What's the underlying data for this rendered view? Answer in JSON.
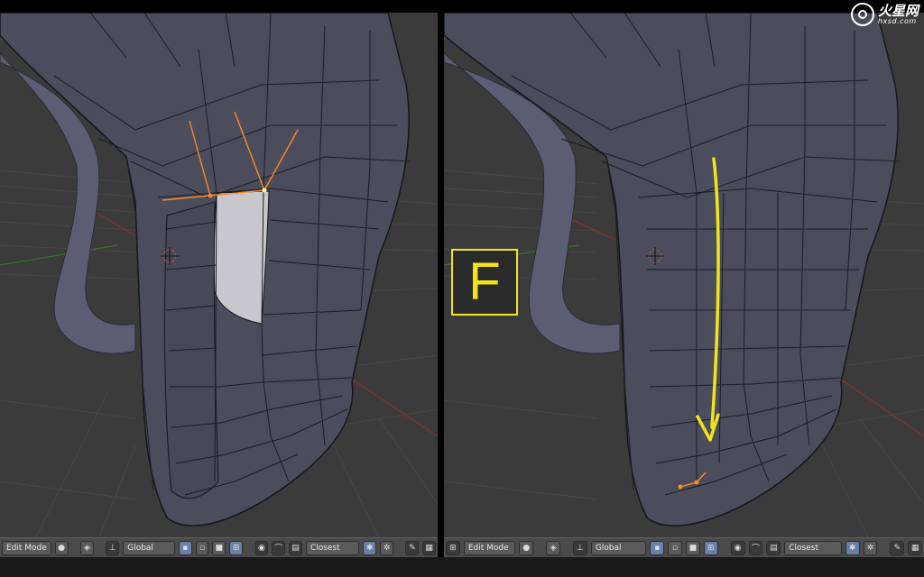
{
  "colors": {
    "viewport_bg": "#3b3b3b",
    "mesh_fill": "#4b4c5c",
    "mesh_edge": "#1a1b22",
    "vertex": "#dcdcdc",
    "selection": "#ff8a1f",
    "annotation": "#f2e418",
    "grid": "#4a4a4a",
    "x_axis": "#a33535",
    "y_axis": "#4f8a2f"
  },
  "annotation": {
    "key_label": "F"
  },
  "logo": {
    "brand_cn": "火星网",
    "brand_en": "hxsd.com"
  },
  "left_panel": {
    "header": {
      "mode_label": "Edit Mode",
      "orientation_label": "Global",
      "snap_label": "Closest"
    }
  },
  "right_panel": {
    "header": {
      "mode_label": "Edit Mode",
      "orientation_label": "Global",
      "snap_label": "Closest"
    }
  }
}
